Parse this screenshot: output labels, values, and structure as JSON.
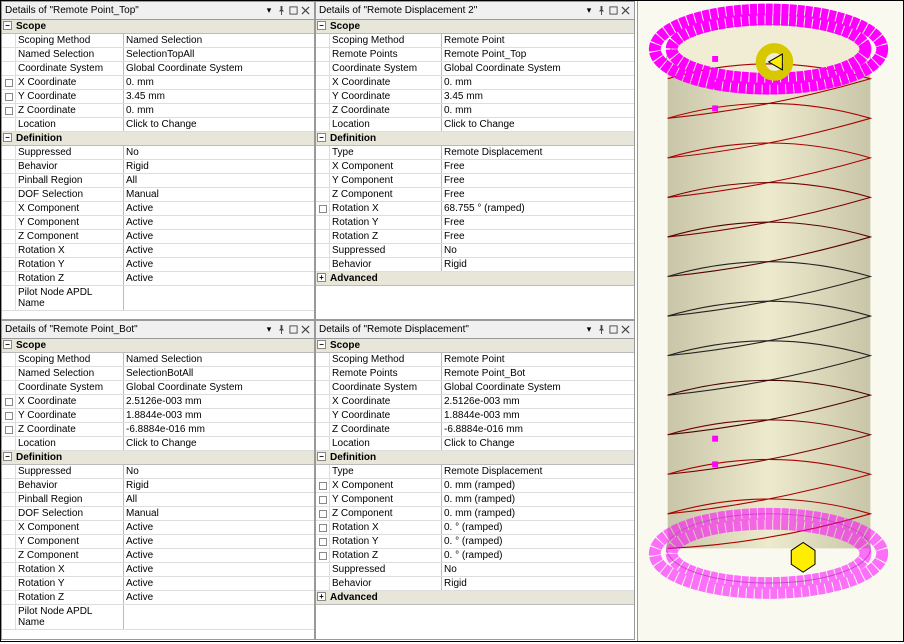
{
  "panels": {
    "p1": {
      "title": "Details of \"Remote Point_Top\"",
      "groups": [
        {
          "name": "Scope",
          "rows": [
            {
              "k": "Scoping Method",
              "v": "Named Selection"
            },
            {
              "k": "Named Selection",
              "v": "SelectionTopAll"
            },
            {
              "k": "Coordinate System",
              "v": "Global Coordinate System"
            },
            {
              "k": "X Coordinate",
              "v": "0. mm",
              "cb": true
            },
            {
              "k": "Y Coordinate",
              "v": "3.45 mm",
              "cb": true
            },
            {
              "k": "Z Coordinate",
              "v": "0. mm",
              "cb": true
            },
            {
              "k": "Location",
              "v": "Click to Change"
            }
          ]
        },
        {
          "name": "Definition",
          "rows": [
            {
              "k": "Suppressed",
              "v": "No"
            },
            {
              "k": "Behavior",
              "v": "Rigid"
            },
            {
              "k": "Pinball Region",
              "v": "All"
            },
            {
              "k": "DOF Selection",
              "v": "Manual"
            },
            {
              "k": "X Component",
              "v": "Active"
            },
            {
              "k": "Y Component",
              "v": "Active"
            },
            {
              "k": "Z Component",
              "v": "Active"
            },
            {
              "k": "Rotation X",
              "v": "Active"
            },
            {
              "k": "Rotation Y",
              "v": "Active"
            },
            {
              "k": "Rotation Z",
              "v": "Active"
            },
            {
              "k": "Pilot Node APDL Name",
              "v": ""
            }
          ]
        }
      ]
    },
    "p2": {
      "title": "Details of \"Remote Displacement 2\"",
      "groups": [
        {
          "name": "Scope",
          "rows": [
            {
              "k": "Scoping Method",
              "v": "Remote Point"
            },
            {
              "k": "Remote Points",
              "v": "Remote Point_Top"
            },
            {
              "k": "Coordinate System",
              "v": "Global Coordinate System"
            },
            {
              "k": "X Coordinate",
              "v": "0. mm"
            },
            {
              "k": "Y Coordinate",
              "v": "3.45 mm"
            },
            {
              "k": "Z Coordinate",
              "v": "0. mm"
            },
            {
              "k": "Location",
              "v": "Click to Change"
            }
          ]
        },
        {
          "name": "Definition",
          "rows": [
            {
              "k": "Type",
              "v": "Remote Displacement"
            },
            {
              "k": "X Component",
              "v": "Free"
            },
            {
              "k": "Y Component",
              "v": "Free"
            },
            {
              "k": "Z Component",
              "v": "Free"
            },
            {
              "k": "Rotation X",
              "v": "68.755 °  (ramped)",
              "cb": true
            },
            {
              "k": "Rotation Y",
              "v": "Free"
            },
            {
              "k": "Rotation Z",
              "v": "Free"
            },
            {
              "k": "Suppressed",
              "v": "No"
            },
            {
              "k": "Behavior",
              "v": "Rigid"
            }
          ]
        },
        {
          "name": "Advanced",
          "collapsed": true,
          "rows": []
        }
      ]
    },
    "p3": {
      "title": "Details of \"Remote Point_Bot\"",
      "groups": [
        {
          "name": "Scope",
          "rows": [
            {
              "k": "Scoping Method",
              "v": "Named Selection"
            },
            {
              "k": "Named Selection",
              "v": "SelectionBotAll"
            },
            {
              "k": "Coordinate System",
              "v": "Global Coordinate System"
            },
            {
              "k": "X Coordinate",
              "v": "2.5126e-003 mm",
              "cb": true
            },
            {
              "k": "Y Coordinate",
              "v": "1.8844e-003 mm",
              "cb": true
            },
            {
              "k": "Z Coordinate",
              "v": "-6.8884e-016 mm",
              "cb": true
            },
            {
              "k": "Location",
              "v": "Click to Change"
            }
          ]
        },
        {
          "name": "Definition",
          "rows": [
            {
              "k": "Suppressed",
              "v": "No"
            },
            {
              "k": "Behavior",
              "v": "Rigid"
            },
            {
              "k": "Pinball Region",
              "v": "All"
            },
            {
              "k": "DOF Selection",
              "v": "Manual"
            },
            {
              "k": "X Component",
              "v": "Active"
            },
            {
              "k": "Y Component",
              "v": "Active"
            },
            {
              "k": "Z Component",
              "v": "Active"
            },
            {
              "k": "Rotation X",
              "v": "Active"
            },
            {
              "k": "Rotation Y",
              "v": "Active"
            },
            {
              "k": "Rotation Z",
              "v": "Active"
            },
            {
              "k": "Pilot Node APDL Name",
              "v": ""
            }
          ]
        }
      ]
    },
    "p4": {
      "title": "Details of \"Remote Displacement\"",
      "groups": [
        {
          "name": "Scope",
          "rows": [
            {
              "k": "Scoping Method",
              "v": "Remote Point"
            },
            {
              "k": "Remote Points",
              "v": "Remote Point_Bot"
            },
            {
              "k": "Coordinate System",
              "v": "Global Coordinate System"
            },
            {
              "k": "X Coordinate",
              "v": "2.5126e-003 mm"
            },
            {
              "k": "Y Coordinate",
              "v": "1.8844e-003 mm"
            },
            {
              "k": "Z Coordinate",
              "v": "-6.8884e-016 mm"
            },
            {
              "k": "Location",
              "v": "Click to Change"
            }
          ]
        },
        {
          "name": "Definition",
          "rows": [
            {
              "k": "Type",
              "v": "Remote Displacement"
            },
            {
              "k": "X Component",
              "v": "0. mm  (ramped)",
              "cb": true
            },
            {
              "k": "Y Component",
              "v": "0. mm  (ramped)",
              "cb": true
            },
            {
              "k": "Z Component",
              "v": "0. mm  (ramped)",
              "cb": true
            },
            {
              "k": "Rotation X",
              "v": "0. °  (ramped)",
              "cb": true
            },
            {
              "k": "Rotation Y",
              "v": "0. °  (ramped)",
              "cb": true
            },
            {
              "k": "Rotation Z",
              "v": "0. °  (ramped)",
              "cb": true
            },
            {
              "k": "Suppressed",
              "v": "No"
            },
            {
              "k": "Behavior",
              "v": "Rigid"
            }
          ]
        },
        {
          "name": "Advanced",
          "collapsed": true,
          "rows": []
        }
      ]
    }
  },
  "colors": {
    "magenta": "#ff00ff",
    "yellow": "#ffdd00",
    "cylinder": "#e6e2c8"
  }
}
